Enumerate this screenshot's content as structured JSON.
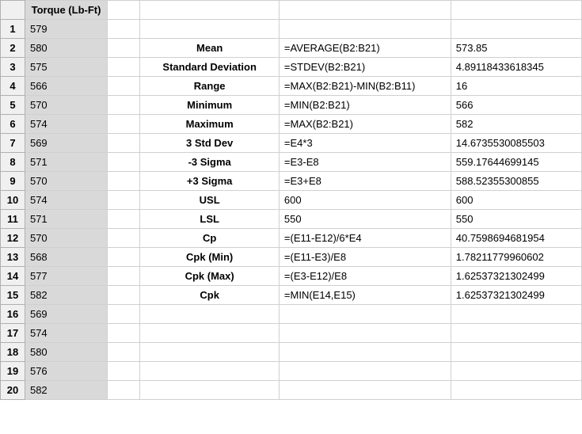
{
  "header": {
    "torque": "Torque (Lb-Ft)"
  },
  "rows": [
    {
      "n": "1",
      "t": "579",
      "lab": "",
      "f": "",
      "r": ""
    },
    {
      "n": "2",
      "t": "580",
      "lab": "Mean",
      "f": "=AVERAGE(B2:B21)",
      "r": "573.85"
    },
    {
      "n": "3",
      "t": "575",
      "lab": "Standard Deviation",
      "f": "=STDEV(B2:B21)",
      "r": "4.89118433618345"
    },
    {
      "n": "4",
      "t": "566",
      "lab": "Range",
      "f": "=MAX(B2:B21)-MIN(B2:B11)",
      "r": "16"
    },
    {
      "n": "5",
      "t": "570",
      "lab": "Minimum",
      "f": "=MIN(B2:B21)",
      "r": "566"
    },
    {
      "n": "6",
      "t": "574",
      "lab": "Maximum",
      "f": "=MAX(B2:B21)",
      "r": "582"
    },
    {
      "n": "7",
      "t": "569",
      "lab": "3 Std Dev",
      "f": "=E4*3",
      "r": "14.6735530085503"
    },
    {
      "n": "8",
      "t": "571",
      "lab": "-3 Sigma",
      "f": "=E3-E8",
      "r": "559.17644699145"
    },
    {
      "n": "9",
      "t": "570",
      "lab": "+3 Sigma",
      "f": "=E3+E8",
      "r": "588.52355300855"
    },
    {
      "n": "10",
      "t": "574",
      "lab": "USL",
      "f": "600",
      "r": "600"
    },
    {
      "n": "11",
      "t": "571",
      "lab": "LSL",
      "f": "550",
      "r": "550"
    },
    {
      "n": "12",
      "t": "570",
      "lab": "Cp",
      "f": "=(E11-E12)/6*E4",
      "r": "40.7598694681954"
    },
    {
      "n": "13",
      "t": "568",
      "lab": "Cpk (Min)",
      "f": "=(E11-E3)/E8",
      "r": "1.78211779960602"
    },
    {
      "n": "14",
      "t": "577",
      "lab": "Cpk (Max)",
      "f": "=(E3-E12)/E8",
      "r": "1.62537321302499"
    },
    {
      "n": "15",
      "t": "582",
      "lab": "Cpk",
      "f": "=MIN(E14,E15)",
      "r": "1.62537321302499"
    },
    {
      "n": "16",
      "t": "569",
      "lab": "",
      "f": "",
      "r": ""
    },
    {
      "n": "17",
      "t": "574",
      "lab": "",
      "f": "",
      "r": ""
    },
    {
      "n": "18",
      "t": "580",
      "lab": "",
      "f": "",
      "r": ""
    },
    {
      "n": "19",
      "t": "576",
      "lab": "",
      "f": "",
      "r": ""
    },
    {
      "n": "20",
      "t": "582",
      "lab": "",
      "f": "",
      "r": ""
    }
  ],
  "chart_data": {
    "type": "table",
    "title": "Torque Statistical Analysis",
    "torque_values": [
      579,
      580,
      575,
      566,
      570,
      574,
      569,
      571,
      570,
      574,
      571,
      570,
      568,
      577,
      582,
      569,
      574,
      580,
      576,
      582
    ],
    "stats": {
      "Mean": 573.85,
      "Standard Deviation": 4.89118433618345,
      "Range": 16,
      "Minimum": 566,
      "Maximum": 582,
      "3 Std Dev": 14.6735530085503,
      "-3 Sigma": 559.17644699145,
      "+3 Sigma": 588.52355300855,
      "USL": 600,
      "LSL": 550,
      "Cp": 40.7598694681954,
      "Cpk (Min)": 1.78211779960602,
      "Cpk (Max)": 1.62537321302499,
      "Cpk": 1.62537321302499
    }
  }
}
